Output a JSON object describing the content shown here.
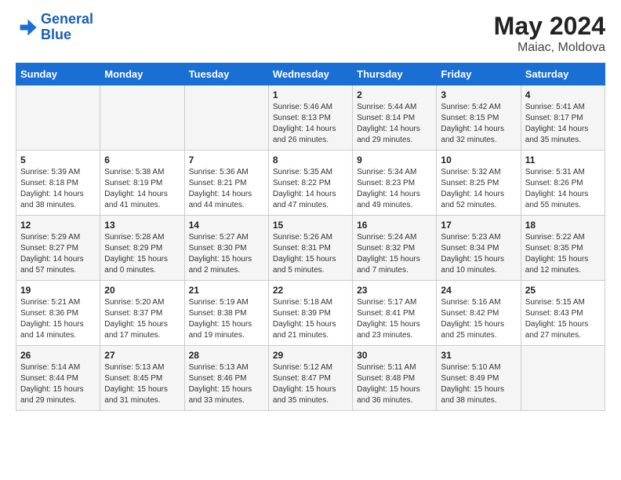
{
  "logo": {
    "line1": "General",
    "line2": "Blue"
  },
  "title": "May 2024",
  "subtitle": "Maiac, Moldova",
  "days_of_week": [
    "Sunday",
    "Monday",
    "Tuesday",
    "Wednesday",
    "Thursday",
    "Friday",
    "Saturday"
  ],
  "weeks": [
    [
      {
        "day": "",
        "content": ""
      },
      {
        "day": "",
        "content": ""
      },
      {
        "day": "",
        "content": ""
      },
      {
        "day": "1",
        "content": "Sunrise: 5:46 AM\nSunset: 8:13 PM\nDaylight: 14 hours\nand 26 minutes."
      },
      {
        "day": "2",
        "content": "Sunrise: 5:44 AM\nSunset: 8:14 PM\nDaylight: 14 hours\nand 29 minutes."
      },
      {
        "day": "3",
        "content": "Sunrise: 5:42 AM\nSunset: 8:15 PM\nDaylight: 14 hours\nand 32 minutes."
      },
      {
        "day": "4",
        "content": "Sunrise: 5:41 AM\nSunset: 8:17 PM\nDaylight: 14 hours\nand 35 minutes."
      }
    ],
    [
      {
        "day": "5",
        "content": "Sunrise: 5:39 AM\nSunset: 8:18 PM\nDaylight: 14 hours\nand 38 minutes."
      },
      {
        "day": "6",
        "content": "Sunrise: 5:38 AM\nSunset: 8:19 PM\nDaylight: 14 hours\nand 41 minutes."
      },
      {
        "day": "7",
        "content": "Sunrise: 5:36 AM\nSunset: 8:21 PM\nDaylight: 14 hours\nand 44 minutes."
      },
      {
        "day": "8",
        "content": "Sunrise: 5:35 AM\nSunset: 8:22 PM\nDaylight: 14 hours\nand 47 minutes."
      },
      {
        "day": "9",
        "content": "Sunrise: 5:34 AM\nSunset: 8:23 PM\nDaylight: 14 hours\nand 49 minutes."
      },
      {
        "day": "10",
        "content": "Sunrise: 5:32 AM\nSunset: 8:25 PM\nDaylight: 14 hours\nand 52 minutes."
      },
      {
        "day": "11",
        "content": "Sunrise: 5:31 AM\nSunset: 8:26 PM\nDaylight: 14 hours\nand 55 minutes."
      }
    ],
    [
      {
        "day": "12",
        "content": "Sunrise: 5:29 AM\nSunset: 8:27 PM\nDaylight: 14 hours\nand 57 minutes."
      },
      {
        "day": "13",
        "content": "Sunrise: 5:28 AM\nSunset: 8:29 PM\nDaylight: 15 hours\nand 0 minutes."
      },
      {
        "day": "14",
        "content": "Sunrise: 5:27 AM\nSunset: 8:30 PM\nDaylight: 15 hours\nand 2 minutes."
      },
      {
        "day": "15",
        "content": "Sunrise: 5:26 AM\nSunset: 8:31 PM\nDaylight: 15 hours\nand 5 minutes."
      },
      {
        "day": "16",
        "content": "Sunrise: 5:24 AM\nSunset: 8:32 PM\nDaylight: 15 hours\nand 7 minutes."
      },
      {
        "day": "17",
        "content": "Sunrise: 5:23 AM\nSunset: 8:34 PM\nDaylight: 15 hours\nand 10 minutes."
      },
      {
        "day": "18",
        "content": "Sunrise: 5:22 AM\nSunset: 8:35 PM\nDaylight: 15 hours\nand 12 minutes."
      }
    ],
    [
      {
        "day": "19",
        "content": "Sunrise: 5:21 AM\nSunset: 8:36 PM\nDaylight: 15 hours\nand 14 minutes."
      },
      {
        "day": "20",
        "content": "Sunrise: 5:20 AM\nSunset: 8:37 PM\nDaylight: 15 hours\nand 17 minutes."
      },
      {
        "day": "21",
        "content": "Sunrise: 5:19 AM\nSunset: 8:38 PM\nDaylight: 15 hours\nand 19 minutes."
      },
      {
        "day": "22",
        "content": "Sunrise: 5:18 AM\nSunset: 8:39 PM\nDaylight: 15 hours\nand 21 minutes."
      },
      {
        "day": "23",
        "content": "Sunrise: 5:17 AM\nSunset: 8:41 PM\nDaylight: 15 hours\nand 23 minutes."
      },
      {
        "day": "24",
        "content": "Sunrise: 5:16 AM\nSunset: 8:42 PM\nDaylight: 15 hours\nand 25 minutes."
      },
      {
        "day": "25",
        "content": "Sunrise: 5:15 AM\nSunset: 8:43 PM\nDaylight: 15 hours\nand 27 minutes."
      }
    ],
    [
      {
        "day": "26",
        "content": "Sunrise: 5:14 AM\nSunset: 8:44 PM\nDaylight: 15 hours\nand 29 minutes."
      },
      {
        "day": "27",
        "content": "Sunrise: 5:13 AM\nSunset: 8:45 PM\nDaylight: 15 hours\nand 31 minutes."
      },
      {
        "day": "28",
        "content": "Sunrise: 5:13 AM\nSunset: 8:46 PM\nDaylight: 15 hours\nand 33 minutes."
      },
      {
        "day": "29",
        "content": "Sunrise: 5:12 AM\nSunset: 8:47 PM\nDaylight: 15 hours\nand 35 minutes."
      },
      {
        "day": "30",
        "content": "Sunrise: 5:11 AM\nSunset: 8:48 PM\nDaylight: 15 hours\nand 36 minutes."
      },
      {
        "day": "31",
        "content": "Sunrise: 5:10 AM\nSunset: 8:49 PM\nDaylight: 15 hours\nand 38 minutes."
      },
      {
        "day": "",
        "content": ""
      }
    ]
  ]
}
